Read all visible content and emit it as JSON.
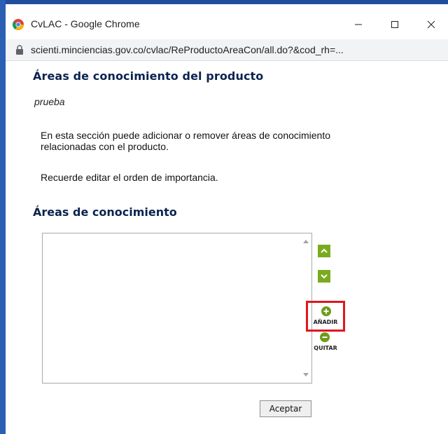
{
  "window": {
    "title": "CvLAC - Google Chrome",
    "controls": [
      "minimize",
      "maximize",
      "close"
    ]
  },
  "address_bar": {
    "url": "scienti.minciencias.gov.co/cvlac/ReProductoAreaCon/all.do?&cod_rh=..."
  },
  "page": {
    "heading": "Áreas de conocimiento del producto",
    "product_name": "prueba",
    "description": "En esta sección puede adicionar o remover áreas de conocimiento relacionadas con el producto.",
    "reminder": "Recuerde editar el orden de importancia.",
    "areas_heading": "Áreas de conocimiento",
    "areas_list": [],
    "buttons": {
      "move_up_icon": "chevron-up-icon",
      "move_down_icon": "chevron-down-icon",
      "add_label": "AÑADIR",
      "remove_label": "QUITAR",
      "accept_label": "Aceptar"
    }
  },
  "colors": {
    "heading": "#0b2350",
    "action_green": "#7aab1f",
    "highlight_red": "#e0161e"
  }
}
